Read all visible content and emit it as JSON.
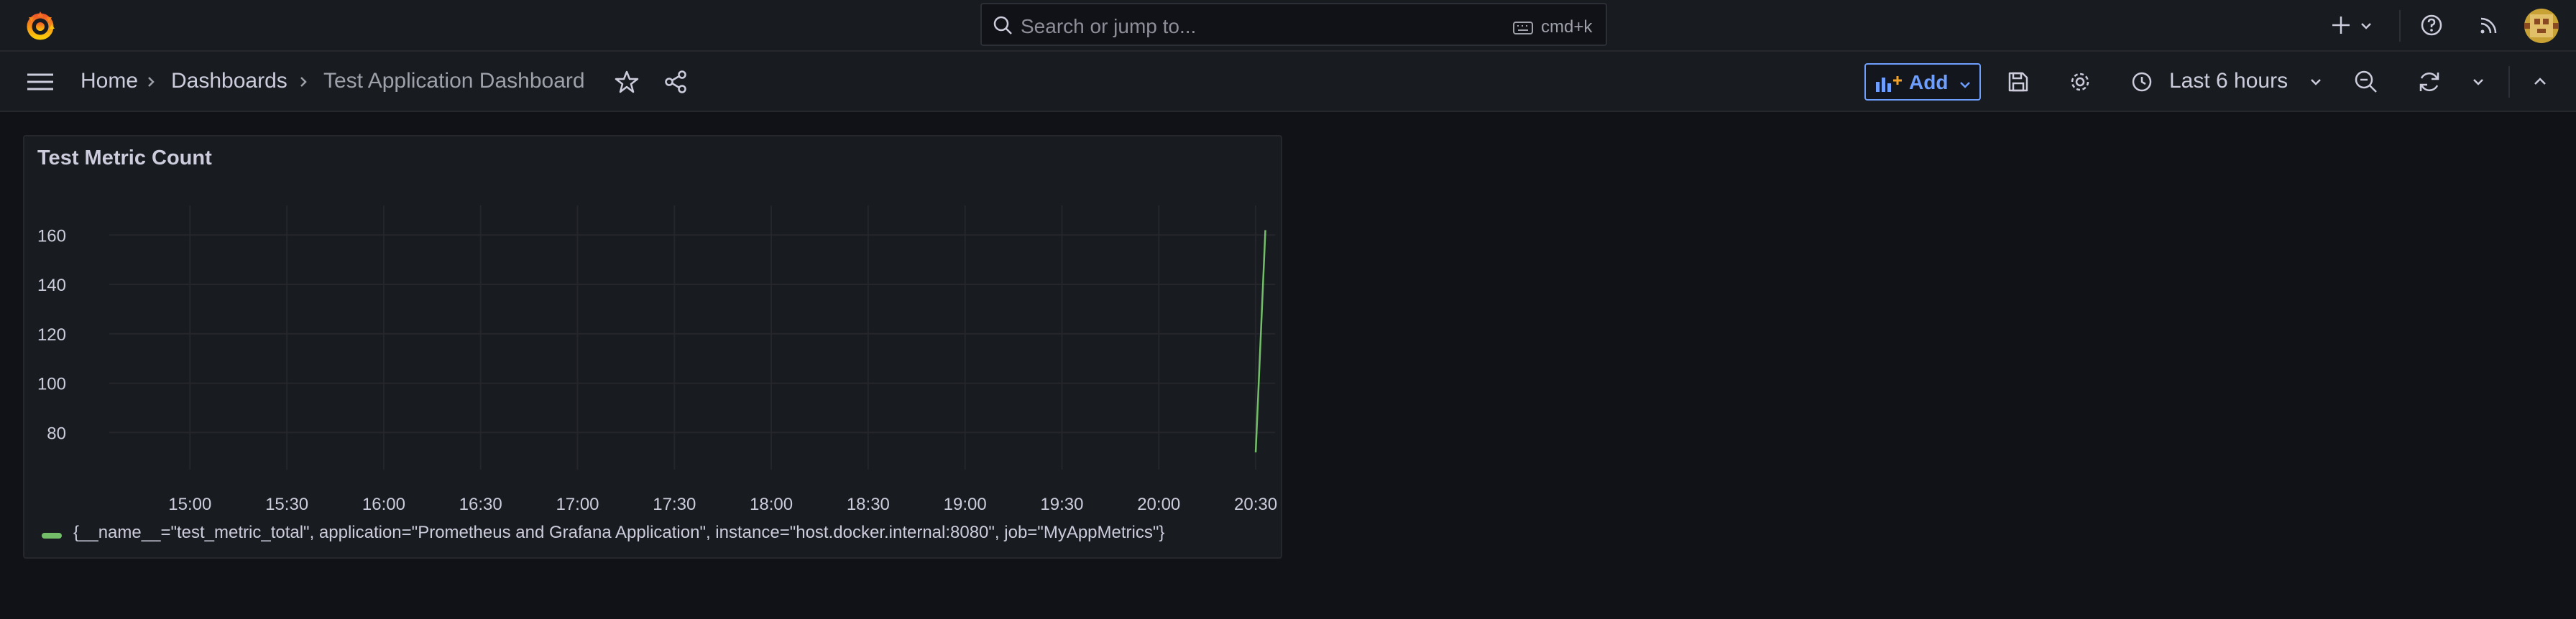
{
  "topbar": {
    "search_placeholder": "Search or jump to...",
    "search_shortcut": "cmd+k"
  },
  "navbar": {
    "breadcrumbs": [
      "Home",
      "Dashboards",
      "Test Application Dashboard"
    ],
    "add_label": "Add",
    "time_range": "Last 6 hours"
  },
  "colors": {
    "accent": "#6e9fff",
    "series": "#73bf69",
    "background": "#111217",
    "panel": "#181b1f"
  },
  "panel": {
    "title": "Test Metric Count",
    "legend": "{__name__=\"test_metric_total\", application=\"Prometheus and Grafana Application\", instance=\"host.docker.internal:8080\", job=\"MyAppMetrics\"}"
  },
  "chart_data": {
    "type": "line",
    "title": "Test Metric Count",
    "x_ticks": [
      "15:00",
      "15:30",
      "16:00",
      "16:30",
      "17:00",
      "17:30",
      "18:00",
      "18:30",
      "19:00",
      "19:30",
      "20:00",
      "20:30"
    ],
    "y_ticks": [
      80,
      100,
      120,
      140,
      160
    ],
    "xlim": [
      "14:35",
      "20:36"
    ],
    "ylim": [
      65,
      172
    ],
    "grid": true,
    "legend_position": "bottom",
    "series": [
      {
        "name": "{__name__=\"test_metric_total\", application=\"Prometheus and Grafana Application\", instance=\"host.docker.internal:8080\", job=\"MyAppMetrics\"}",
        "points": [
          [
            "20:30",
            72
          ],
          [
            "20:33",
            162
          ]
        ]
      }
    ]
  }
}
